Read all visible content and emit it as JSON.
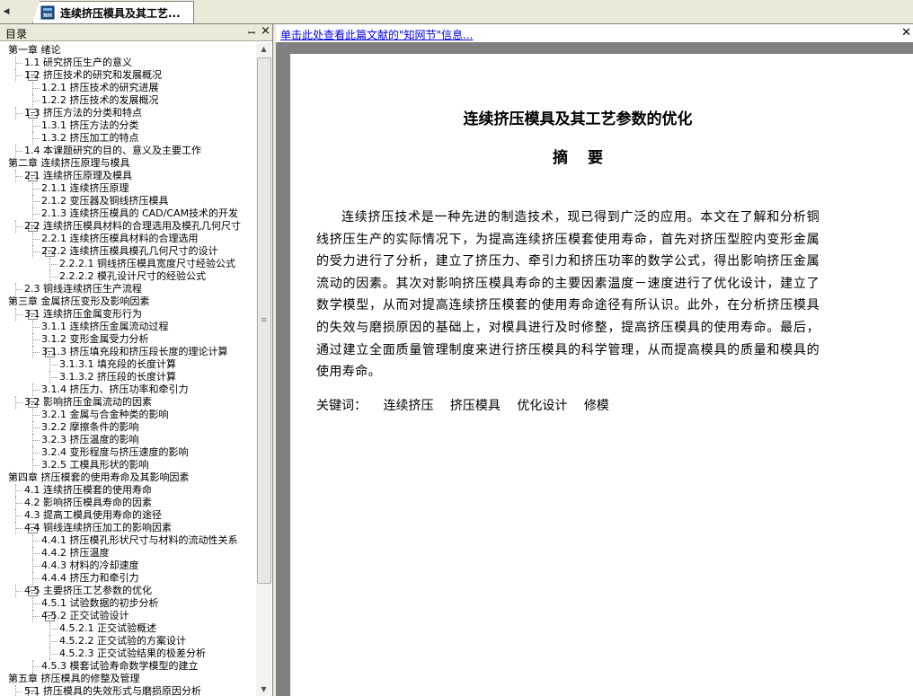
{
  "tab": {
    "title": "连续挤压模具及其工艺..."
  },
  "toc": {
    "title": "目录",
    "items": [
      {
        "label": "第一章 绪论",
        "level": 0,
        "toggle": ""
      },
      {
        "label": "1.1 研究挤压生产的意义",
        "level": 1,
        "toggle": ""
      },
      {
        "label": "1.2 挤压技术的研究和发展概况",
        "level": 1,
        "toggle": "−"
      },
      {
        "label": "1.2.1 挤压技术的研究进展",
        "level": 2,
        "toggle": ""
      },
      {
        "label": "1.2.2 挤压技术的发展概况",
        "level": 2,
        "toggle": ""
      },
      {
        "label": "1.3 挤压方法的分类和特点",
        "level": 1,
        "toggle": "−"
      },
      {
        "label": "1.3.1 挤压方法的分类",
        "level": 2,
        "toggle": ""
      },
      {
        "label": "1.3.2 挤压加工的特点",
        "level": 2,
        "toggle": ""
      },
      {
        "label": "1.4 本课题研究的目的、意义及主要工作",
        "level": 1,
        "toggle": ""
      },
      {
        "label": "第二章 连续挤压原理与模具",
        "level": 0,
        "toggle": ""
      },
      {
        "label": "2.1 连续挤压原理及模具",
        "level": 1,
        "toggle": "−"
      },
      {
        "label": "2.1.1 连续挤压原理",
        "level": 2,
        "toggle": ""
      },
      {
        "label": "2.1.2 变压器及铜线挤压模具",
        "level": 2,
        "toggle": ""
      },
      {
        "label": "2.1.3 连续挤压模具的 CAD/CAM技术的开发",
        "level": 2,
        "toggle": ""
      },
      {
        "label": "2.2 连续挤压模具材料的合理选用及模孔几何尺寸",
        "level": 1,
        "toggle": "−"
      },
      {
        "label": "2.2.1 连续挤压模具材料的合理选用",
        "level": 2,
        "toggle": ""
      },
      {
        "label": "2.2.2 连续挤压模具模孔几何尺寸的设计",
        "level": 2,
        "toggle": "−"
      },
      {
        "label": "2.2.2.1 铜线挤压模具宽度尺寸经验公式",
        "level": 3,
        "toggle": ""
      },
      {
        "label": "2.2.2.2 模孔设计尺寸的经验公式",
        "level": 3,
        "toggle": ""
      },
      {
        "label": "2.3 铜线连续挤压生产流程",
        "level": 1,
        "toggle": ""
      },
      {
        "label": "第三章 金属挤压变形及影响因素",
        "level": 0,
        "toggle": ""
      },
      {
        "label": "3.1 连续挤压金属变形行为",
        "level": 1,
        "toggle": "−"
      },
      {
        "label": "3.1.1 连续挤压金属流动过程",
        "level": 2,
        "toggle": ""
      },
      {
        "label": "3.1.2 变形金属受力分析",
        "level": 2,
        "toggle": ""
      },
      {
        "label": "3.1.3 挤压填充段和挤压段长度的理论计算",
        "level": 2,
        "toggle": "−"
      },
      {
        "label": "3.1.3.1 填充段的长度计算",
        "level": 3,
        "toggle": ""
      },
      {
        "label": "3.1.3.2 挤压段的长度计算",
        "level": 3,
        "toggle": ""
      },
      {
        "label": "3.1.4 挤压力、挤压功率和牵引力",
        "level": 2,
        "toggle": ""
      },
      {
        "label": "3.2 影响挤压金属流动的因素",
        "level": 1,
        "toggle": "−"
      },
      {
        "label": "3.2.1 金属与合金种类的影响",
        "level": 2,
        "toggle": ""
      },
      {
        "label": "3.2.2 摩擦条件的影响",
        "level": 2,
        "toggle": ""
      },
      {
        "label": "3.2.3 挤压温度的影响",
        "level": 2,
        "toggle": ""
      },
      {
        "label": "3.2.4 变形程度与挤压速度的影响",
        "level": 2,
        "toggle": ""
      },
      {
        "label": "3.2.5 工模具形状的影响",
        "level": 2,
        "toggle": ""
      },
      {
        "label": "第四章 挤压模套的使用寿命及其影响因素",
        "level": 0,
        "toggle": ""
      },
      {
        "label": "4.1 连续挤压模套的使用寿命",
        "level": 1,
        "toggle": ""
      },
      {
        "label": "4.2 影响挤压模具寿命的因素",
        "level": 1,
        "toggle": ""
      },
      {
        "label": "4.3 提高工模具使用寿命的途径",
        "level": 1,
        "toggle": ""
      },
      {
        "label": "4.4 铜线连续挤压加工的影响因素",
        "level": 1,
        "toggle": "−"
      },
      {
        "label": "4.4.1 挤压模孔形状尺寸与材料的流动性关系",
        "level": 2,
        "toggle": ""
      },
      {
        "label": "4.4.2 挤压温度",
        "level": 2,
        "toggle": ""
      },
      {
        "label": "4.4.3 材料的冷却速度",
        "level": 2,
        "toggle": ""
      },
      {
        "label": "4.4.4 挤压力和牵引力",
        "level": 2,
        "toggle": ""
      },
      {
        "label": "4.5 主要挤压工艺参数的优化",
        "level": 1,
        "toggle": "−"
      },
      {
        "label": "4.5.1 试验数据的初步分析",
        "level": 2,
        "toggle": ""
      },
      {
        "label": "4.5.2 正交试验设计",
        "level": 2,
        "toggle": "−"
      },
      {
        "label": "4.5.2.1 正交试验概述",
        "level": 3,
        "toggle": ""
      },
      {
        "label": "4.5.2.2 正交试验的方案设计",
        "level": 3,
        "toggle": ""
      },
      {
        "label": "4.5.2.3 正交试验结果的极差分析",
        "level": 3,
        "toggle": ""
      },
      {
        "label": "4.5.3 模套试验寿命数学模型的建立",
        "level": 2,
        "toggle": ""
      },
      {
        "label": "第五章 挤压模具的修整及管理",
        "level": 0,
        "toggle": ""
      },
      {
        "label": "5.1 挤压模具的失效形式与磨损原因分析",
        "level": 1,
        "toggle": "−"
      }
    ]
  },
  "info_bar": {
    "link_text": "单击此处查看此篇文献的\"知网节\"信息..."
  },
  "document": {
    "title": "连续挤压模具及其工艺参数的优化",
    "abstract_heading": "摘要",
    "abstract": "连续挤压技术是一种先进的制造技术，现已得到广泛的应用。本文在了解和分析铜线挤压生产的实际情况下，为提高连续挤压模套使用寿命，首先对挤压型腔内变形金属的受力进行了分析，建立了挤压力、牵引力和挤压功率的数学公式，得出影响挤压金属流动的因素。其次对影响挤压模具寿命的主要因素温度－速度进行了优化设计，建立了数学模型，从而对提高连续挤压模套的使用寿命途径有所认识。此外，在分析挤压模具的失效与磨损原因的基础上，对模具进行及时修整，提高挤压模具的使用寿命。最后，通过建立全面质量管理制度来进行挤压模具的科学管理，从而提高模具的质量和模具的使用寿命。",
    "keywords_label": "关键词：",
    "keywords": [
      "连续挤压",
      "挤压模具",
      "优化设计",
      "修模"
    ]
  }
}
